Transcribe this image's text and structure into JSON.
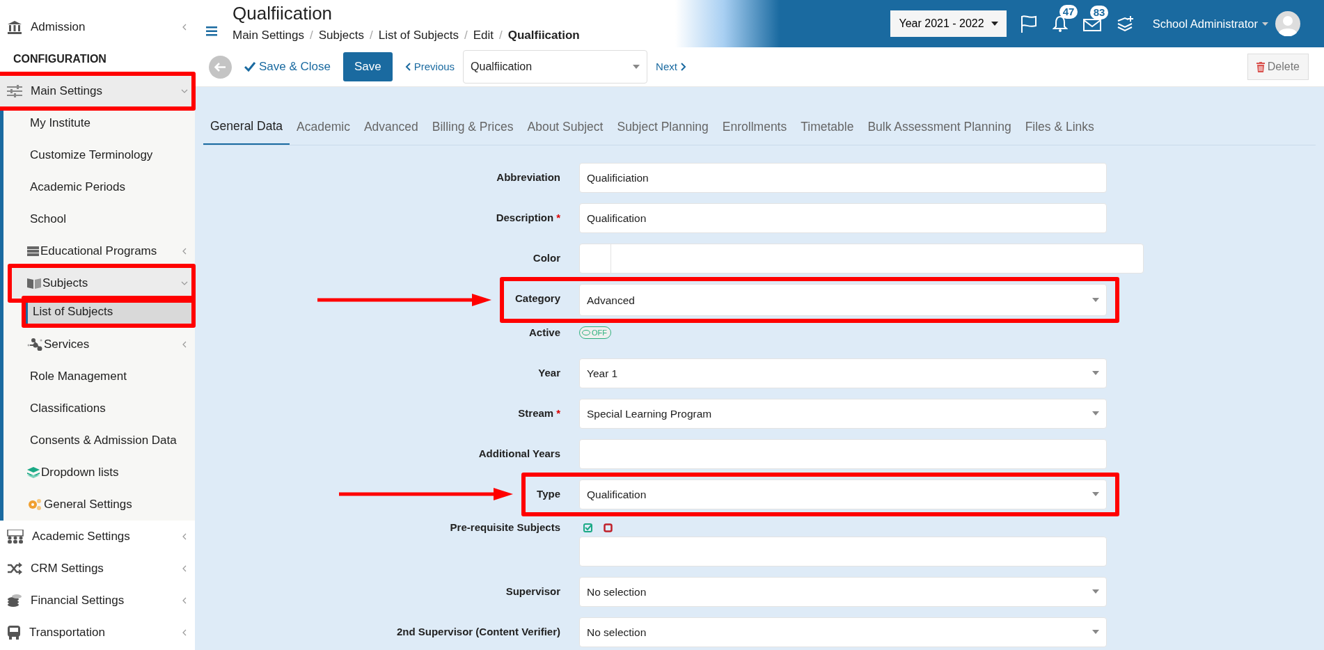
{
  "sidebar": {
    "items": [
      {
        "kind": "item",
        "label": "Admission",
        "expanded": false,
        "selected": false,
        "highlighted": false
      },
      {
        "kind": "header",
        "label": "CONFIGURATION"
      },
      {
        "kind": "item",
        "label": "Main Settings",
        "expanded": true,
        "selected": false,
        "highlighted": true,
        "children": [
          {
            "label": "My Institute",
            "selected": false,
            "highlighted": false
          },
          {
            "label": "Customize Terminology",
            "selected": false,
            "highlighted": false
          },
          {
            "label": "Academic Periods",
            "selected": false,
            "highlighted": false
          },
          {
            "label": "School",
            "selected": false,
            "highlighted": false
          },
          {
            "label": "Educational Programs",
            "expanded": false,
            "selected": false,
            "highlighted": false
          },
          {
            "label": "Subjects",
            "expanded": true,
            "selected": false,
            "highlighted": true,
            "children": [
              {
                "label": "List of Subjects",
                "selected": true,
                "highlighted": true
              }
            ]
          },
          {
            "label": "Services",
            "expanded": false,
            "selected": false,
            "highlighted": false
          },
          {
            "label": "Role Management",
            "selected": false,
            "highlighted": false
          },
          {
            "label": "Classifications",
            "selected": false,
            "highlighted": false
          },
          {
            "label": "Consents & Admission Data",
            "selected": false,
            "highlighted": false
          },
          {
            "label": "Dropdown lists",
            "selected": false,
            "highlighted": false
          },
          {
            "label": "General Settings",
            "selected": false,
            "highlighted": false
          }
        ]
      },
      {
        "kind": "item",
        "label": "Academic Settings",
        "expanded": false,
        "selected": false,
        "highlighted": false
      },
      {
        "kind": "item",
        "label": "CRM Settings",
        "expanded": false,
        "selected": false,
        "highlighted": false
      },
      {
        "kind": "item",
        "label": "Financial Settings",
        "expanded": false,
        "selected": false,
        "highlighted": false
      },
      {
        "kind": "item",
        "label": "Transportation",
        "expanded": false,
        "selected": false,
        "highlighted": false
      }
    ]
  },
  "header": {
    "title": "Qualfiication",
    "breadcrumbs": [
      {
        "label": "Main Settings",
        "current": false
      },
      {
        "separator": "/",
        "label": "Subjects",
        "current": false
      },
      {
        "separator": "/",
        "label": "List of Subjects",
        "current": false
      },
      {
        "separator": "/",
        "label": "Edit",
        "current": false
      },
      {
        "separator": "/",
        "label": "Qualfiication",
        "current": true
      }
    ],
    "year": "Year 2021 - 2022",
    "notifications": "47",
    "messages": "83",
    "user": "School Administrator"
  },
  "toolbar": {
    "save_close": "Save & Close",
    "save": "Save",
    "previous": "Previous",
    "record": "Qualfiication",
    "next": "Next",
    "delete": "Delete"
  },
  "tabs": [
    {
      "label": "General Data",
      "selected": true
    },
    {
      "label": "Academic",
      "selected": false
    },
    {
      "label": "Advanced",
      "selected": false
    },
    {
      "label": "Billing & Prices",
      "selected": false
    },
    {
      "label": "About Subject",
      "selected": false
    },
    {
      "label": "Subject Planning",
      "selected": false
    },
    {
      "label": "Enrollments",
      "selected": false
    },
    {
      "label": "Timetable",
      "selected": false
    },
    {
      "label": "Bulk Assessment Planning",
      "selected": false
    },
    {
      "label": "Files & Links",
      "selected": false
    }
  ],
  "form": [
    {
      "kind": "text",
      "label": "Abbreviation",
      "highlighted": false,
      "value": "Qualificiation"
    },
    {
      "kind": "text",
      "label": "Description",
      "required_mark": "*",
      "highlighted": false,
      "value": "Qualification"
    },
    {
      "kind": "color",
      "label": "Color",
      "highlighted": false
    },
    {
      "kind": "select",
      "label": "Category",
      "highlighted": true,
      "value": "Advanced"
    },
    {
      "kind": "toggle",
      "label": "Active",
      "highlighted": false,
      "on": false,
      "text": "OFF"
    },
    {
      "kind": "select",
      "label": "Year",
      "highlighted": false,
      "value": "Year 1"
    },
    {
      "kind": "select",
      "label": "Stream",
      "required_mark": "*",
      "highlighted": false,
      "value": "Special Learning Program"
    },
    {
      "kind": "text",
      "label": "Additional Years",
      "highlighted": false
    },
    {
      "kind": "select",
      "label": "Type",
      "highlighted": true,
      "value": "Qualification"
    },
    {
      "kind": "multi",
      "label": "Pre-requisite Subjects",
      "highlighted": false
    },
    {
      "kind": "select",
      "label": "Supervisor",
      "highlighted": false,
      "value": "No selection"
    },
    {
      "kind": "select",
      "label": "2nd Supervisor (Content Verifier)",
      "highlighted": false,
      "value": "No selection"
    }
  ]
}
